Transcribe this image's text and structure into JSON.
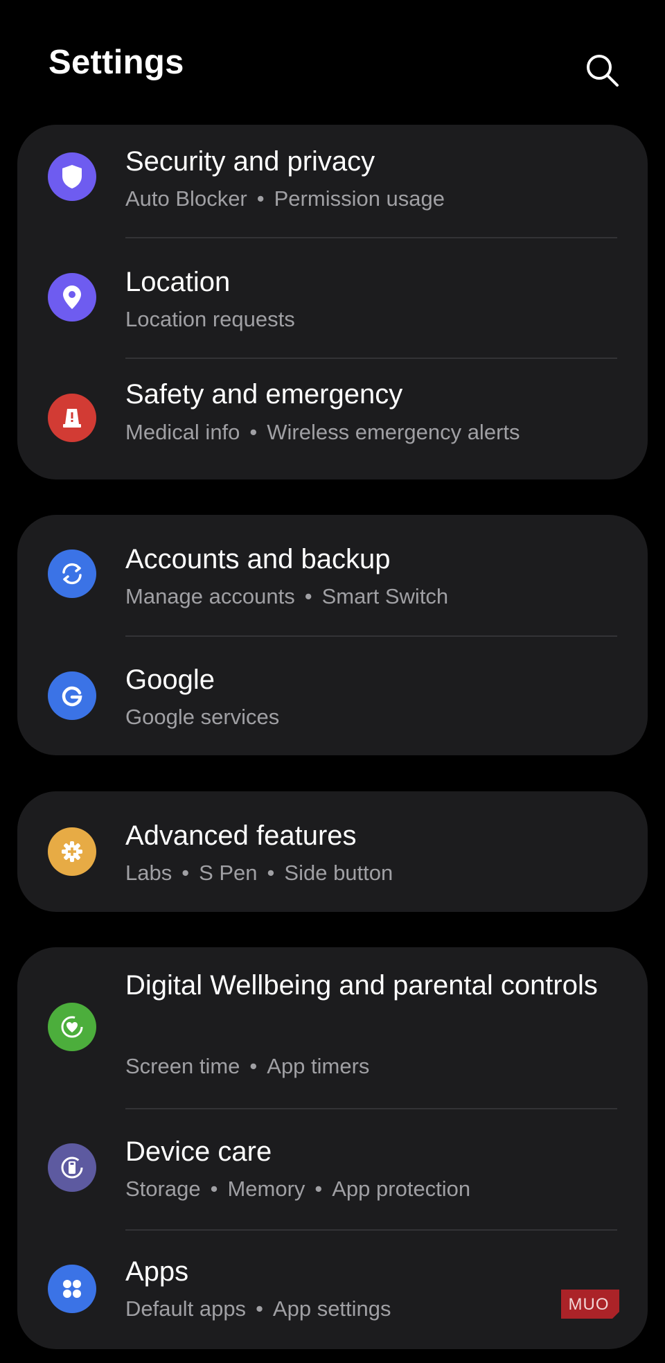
{
  "header": {
    "title": "Settings",
    "search_icon": "search-icon"
  },
  "groups": [
    {
      "items": [
        {
          "title": "Security and privacy",
          "subtitle": [
            "Auto Blocker",
            "Permission usage"
          ],
          "icon": "shield-icon",
          "icon_color": "#6e5cf0"
        },
        {
          "title": "Location",
          "subtitle": [
            "Location requests"
          ],
          "icon": "location-pin-icon",
          "icon_color": "#6e5cf0"
        },
        {
          "title": "Safety and emergency",
          "subtitle": [
            "Medical info",
            "Wireless emergency alerts"
          ],
          "icon": "emergency-alert-icon",
          "icon_color": "#d23b34"
        }
      ]
    },
    {
      "items": [
        {
          "title": "Accounts and backup",
          "subtitle": [
            "Manage accounts",
            "Smart Switch"
          ],
          "icon": "sync-icon",
          "icon_color": "#3b73e6"
        },
        {
          "title": "Google",
          "subtitle": [
            "Google services"
          ],
          "icon": "google-icon",
          "icon_color": "#3b73e6"
        }
      ]
    },
    {
      "items": [
        {
          "title": "Advanced features",
          "subtitle": [
            "Labs",
            "S Pen",
            "Side button"
          ],
          "icon": "gear-plus-icon",
          "icon_color": "#e7ab45"
        }
      ]
    },
    {
      "items": [
        {
          "title": "Digital Wellbeing and parental controls",
          "subtitle": [
            "Screen time",
            "App timers"
          ],
          "icon": "wellbeing-heart-icon",
          "icon_color": "#4cae3c"
        },
        {
          "title": "Device care",
          "subtitle": [
            "Storage",
            "Memory",
            "App protection"
          ],
          "icon": "device-care-icon",
          "icon_color": "#5d5aa0"
        },
        {
          "title": "Apps",
          "subtitle": [
            "Default apps",
            "App settings"
          ],
          "icon": "apps-grid-icon",
          "icon_color": "#3b73e6"
        }
      ]
    }
  ],
  "watermark": {
    "text": "MUO",
    "color": "#c4242a"
  }
}
